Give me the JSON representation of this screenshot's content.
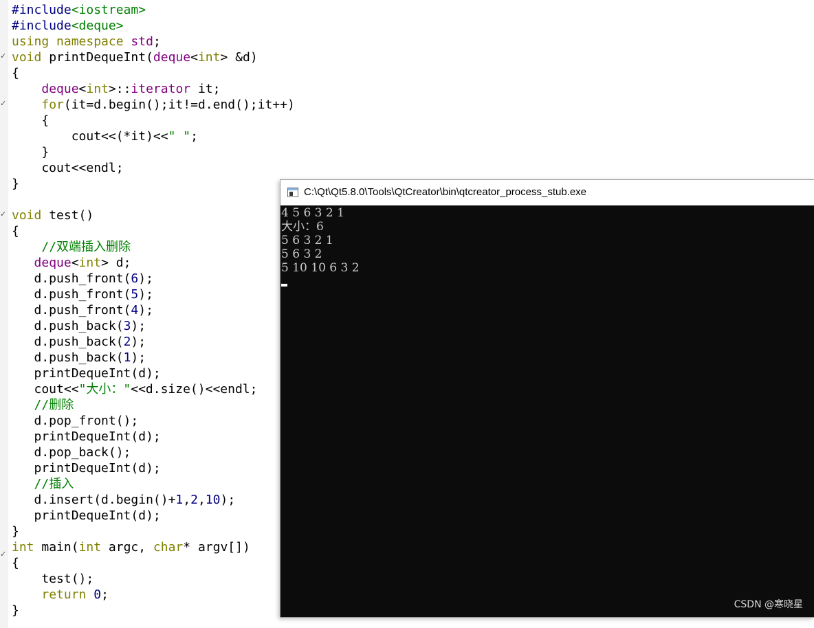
{
  "editor": {
    "fold_marker_glyph": "✓",
    "lines": [
      [
        {
          "t": "#include",
          "c": "pre"
        },
        {
          "t": "<iostream>",
          "c": "inc"
        }
      ],
      [
        {
          "t": "#include",
          "c": "pre"
        },
        {
          "t": "<deque>",
          "c": "inc"
        }
      ],
      [
        {
          "t": "using",
          "c": "kw"
        },
        {
          "t": " ",
          "c": "plain"
        },
        {
          "t": "namespace",
          "c": "kw"
        },
        {
          "t": " ",
          "c": "plain"
        },
        {
          "t": "std",
          "c": "type"
        },
        {
          "t": ";",
          "c": "plain"
        }
      ],
      [
        {
          "t": "void",
          "c": "kw"
        },
        {
          "t": " printDequeInt(",
          "c": "plain"
        },
        {
          "t": "deque",
          "c": "type"
        },
        {
          "t": "<",
          "c": "plain"
        },
        {
          "t": "int",
          "c": "kw"
        },
        {
          "t": "> &d)",
          "c": "plain"
        }
      ],
      [
        {
          "t": "{",
          "c": "plain"
        }
      ],
      [
        {
          "t": "    ",
          "c": "plain"
        },
        {
          "t": "deque",
          "c": "type"
        },
        {
          "t": "<",
          "c": "plain"
        },
        {
          "t": "int",
          "c": "kw"
        },
        {
          "t": ">::",
          "c": "plain"
        },
        {
          "t": "iterator",
          "c": "type"
        },
        {
          "t": " it;",
          "c": "plain"
        }
      ],
      [
        {
          "t": "    ",
          "c": "plain"
        },
        {
          "t": "for",
          "c": "kw"
        },
        {
          "t": "(it=d.begin();it!=d.end();it++)",
          "c": "plain"
        }
      ],
      [
        {
          "t": "    {",
          "c": "plain"
        }
      ],
      [
        {
          "t": "        cout<<(*it)<<",
          "c": "plain"
        },
        {
          "t": "\" \"",
          "c": "str"
        },
        {
          "t": ";",
          "c": "plain"
        }
      ],
      [
        {
          "t": "    }",
          "c": "plain"
        }
      ],
      [
        {
          "t": "    cout<<endl;",
          "c": "plain"
        }
      ],
      [
        {
          "t": "}",
          "c": "plain"
        }
      ],
      [],
      [
        {
          "t": "void",
          "c": "kw"
        },
        {
          "t": " test()",
          "c": "plain"
        }
      ],
      [
        {
          "t": "{",
          "c": "plain"
        }
      ],
      [
        {
          "t": "    ",
          "c": "plain"
        },
        {
          "t": "//双端插入删除",
          "c": "cmt"
        }
      ],
      [
        {
          "t": "   ",
          "c": "plain"
        },
        {
          "t": "deque",
          "c": "type"
        },
        {
          "t": "<",
          "c": "plain"
        },
        {
          "t": "int",
          "c": "kw"
        },
        {
          "t": "> d;",
          "c": "plain"
        }
      ],
      [
        {
          "t": "   d.push_front(",
          "c": "plain"
        },
        {
          "t": "6",
          "c": "num"
        },
        {
          "t": ");",
          "c": "plain"
        }
      ],
      [
        {
          "t": "   d.push_front(",
          "c": "plain"
        },
        {
          "t": "5",
          "c": "num"
        },
        {
          "t": ");",
          "c": "plain"
        }
      ],
      [
        {
          "t": "   d.push_front(",
          "c": "plain"
        },
        {
          "t": "4",
          "c": "num"
        },
        {
          "t": ");",
          "c": "plain"
        }
      ],
      [
        {
          "t": "   d.push_back(",
          "c": "plain"
        },
        {
          "t": "3",
          "c": "num"
        },
        {
          "t": ");",
          "c": "plain"
        }
      ],
      [
        {
          "t": "   d.push_back(",
          "c": "plain"
        },
        {
          "t": "2",
          "c": "num"
        },
        {
          "t": ");",
          "c": "plain"
        }
      ],
      [
        {
          "t": "   d.push_back(",
          "c": "plain"
        },
        {
          "t": "1",
          "c": "num"
        },
        {
          "t": ");",
          "c": "plain"
        }
      ],
      [
        {
          "t": "   printDequeInt(d);",
          "c": "plain"
        }
      ],
      [
        {
          "t": "   cout<<",
          "c": "plain"
        },
        {
          "t": "\"大小：\"",
          "c": "str"
        },
        {
          "t": "<<d.size()<<endl;",
          "c": "plain"
        }
      ],
      [
        {
          "t": "   ",
          "c": "plain"
        },
        {
          "t": "//删除",
          "c": "cmt"
        }
      ],
      [
        {
          "t": "   d.pop_front();",
          "c": "plain"
        }
      ],
      [
        {
          "t": "   printDequeInt(d);",
          "c": "plain"
        }
      ],
      [
        {
          "t": "   d.pop_back();",
          "c": "plain"
        }
      ],
      [
        {
          "t": "   printDequeInt(d);",
          "c": "plain"
        }
      ],
      [
        {
          "t": "   ",
          "c": "plain"
        },
        {
          "t": "//插入",
          "c": "cmt"
        }
      ],
      [
        {
          "t": "   d.insert(d.begin()+",
          "c": "plain"
        },
        {
          "t": "1",
          "c": "num"
        },
        {
          "t": ",",
          "c": "plain"
        },
        {
          "t": "2",
          "c": "num"
        },
        {
          "t": ",",
          "c": "plain"
        },
        {
          "t": "10",
          "c": "num"
        },
        {
          "t": ");",
          "c": "plain"
        }
      ],
      [
        {
          "t": "   printDequeInt(d);",
          "c": "plain"
        }
      ],
      [
        {
          "t": "}",
          "c": "plain"
        }
      ],
      [
        {
          "t": "int",
          "c": "kw"
        },
        {
          "t": " main(",
          "c": "plain"
        },
        {
          "t": "int",
          "c": "kw"
        },
        {
          "t": " argc, ",
          "c": "plain"
        },
        {
          "t": "char",
          "c": "kw"
        },
        {
          "t": "* argv[])",
          "c": "plain"
        }
      ],
      [
        {
          "t": "{",
          "c": "plain"
        }
      ],
      [
        {
          "t": "    test();",
          "c": "plain"
        }
      ],
      [
        {
          "t": "    ",
          "c": "plain"
        },
        {
          "t": "return",
          "c": "kw"
        },
        {
          "t": " ",
          "c": "plain"
        },
        {
          "t": "0",
          "c": "num"
        },
        {
          "t": ";",
          "c": "plain"
        }
      ],
      [
        {
          "t": "}",
          "c": "plain"
        }
      ]
    ]
  },
  "console": {
    "title": "C:\\Qt\\Qt5.8.0\\Tools\\QtCreator\\bin\\qtcreator_process_stub.exe",
    "icon": "console-window-icon",
    "output_lines": [
      "4 5 6 3 2 1",
      "大小：6",
      "5 6 3 2 1",
      "5 6 3 2",
      "5 10 10 6 3 2"
    ],
    "cursor_color": "#ffffff",
    "background_color": "#0c0c0c"
  },
  "watermark": "CSDN @寒晓星",
  "colors": {
    "preprocessor": "#000080",
    "include": "#008000",
    "keyword": "#808000",
    "type": "#800080",
    "number": "#000080",
    "string": "#008000",
    "comment": "#008000"
  }
}
